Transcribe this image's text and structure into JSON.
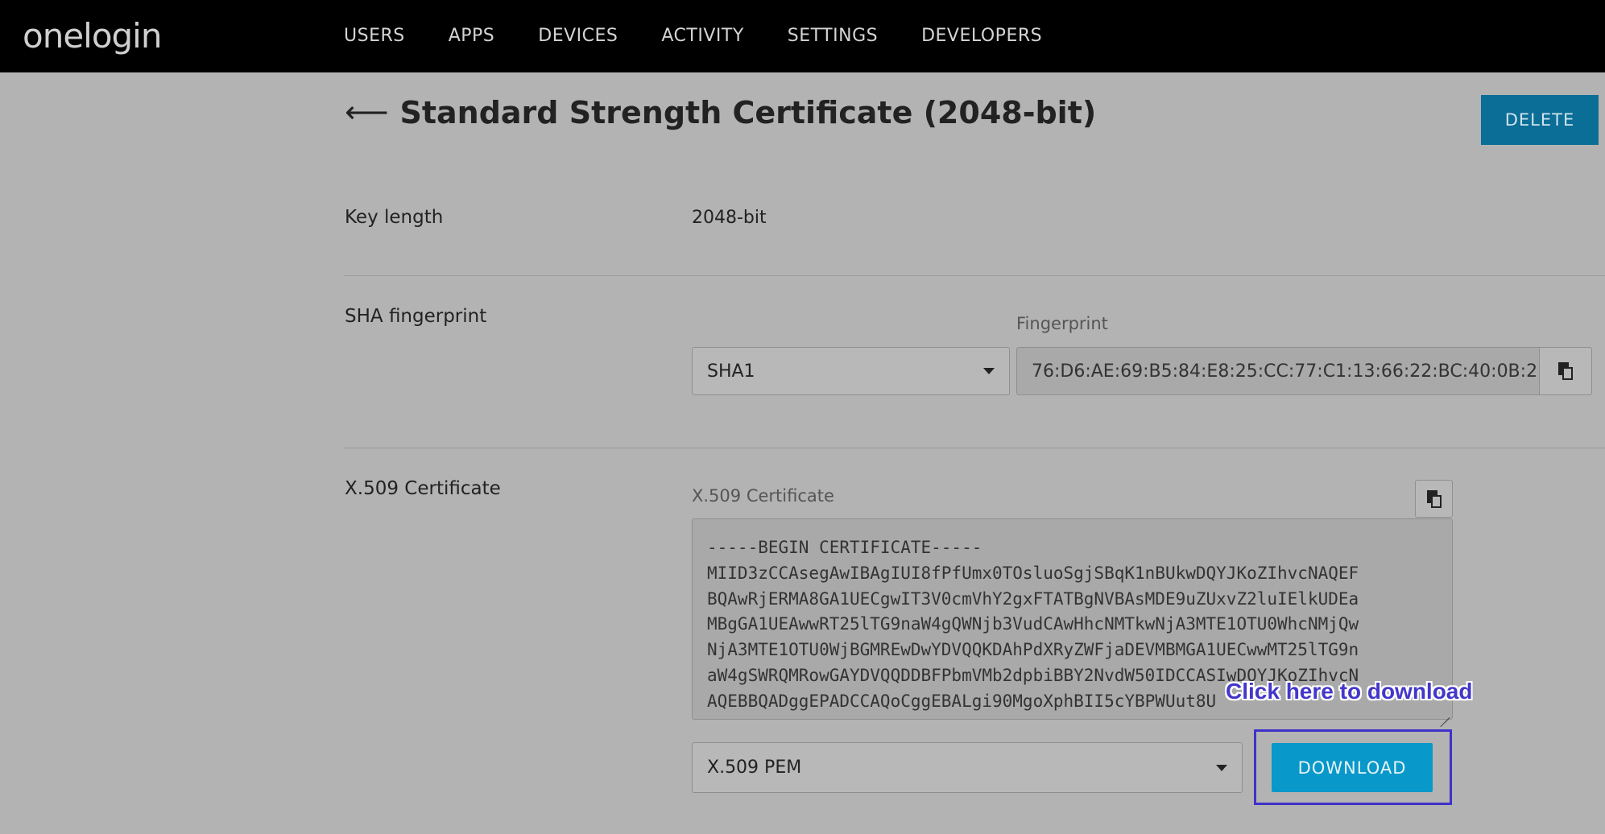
{
  "app": {
    "logo": "onelogin"
  },
  "nav": {
    "items": [
      {
        "label": "USERS"
      },
      {
        "label": "APPS"
      },
      {
        "label": "DEVICES"
      },
      {
        "label": "ACTIVITY"
      },
      {
        "label": "SETTINGS"
      },
      {
        "label": "DEVELOPERS"
      }
    ]
  },
  "page": {
    "back_glyph": "⟵",
    "title": "Standard Strength Certificate (2048-bit)",
    "delete_label": "DELETE"
  },
  "key_length": {
    "label": "Key length",
    "value": "2048-bit"
  },
  "sha": {
    "label": "SHA fingerprint",
    "algorithm": "SHA1",
    "fingerprint_label": "Fingerprint",
    "fingerprint_value": "76:D6:AE:69:B5:84:E8:25:CC:77:C1:13:66:22:BC:40:0B:2"
  },
  "x509": {
    "label": "X.509 Certificate",
    "field_label": "X.509 Certificate",
    "certificate": "-----BEGIN CERTIFICATE-----\nMIID3zCCAsegAwIBAgIUI8fPfUmx0TOsluoSgjSBqK1nBUkwDQYJKoZIhvcNAQEF\nBQAwRjERMA8GA1UECgwIT3V0cmVhY2gxFTATBgNVBAsMDE9uZUxvZ2luIElkUDEa\nMBgGA1UEAwwRT25lTG9naW4gQWNjb3VudCAwHhcNMTkwNjA3MTE1OTU0WhcNMjQw\nNjA3MTE1OTU0WjBGMREwDwYDVQQKDAhPdXRyZWFjaDEVMBMGA1UECwwMT25lTG9n\naW4gSWRQMRowGAYDVQQDDBFPbmVMb2dpbiBBY2NvdW50IDCCASIwDQYJKoZIhvcN\nAQEBBQADggEPADCCAQoCggEBALgi90MgoXphBII5cYBPWUut8U",
    "format": "X.509 PEM",
    "download_label": "DOWNLOAD",
    "hint": "Click here to download"
  }
}
